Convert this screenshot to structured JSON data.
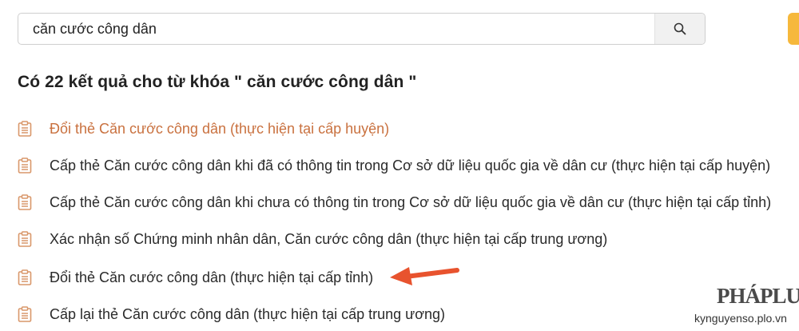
{
  "search": {
    "value": "căn cước công dân",
    "placeholder": ""
  },
  "results": {
    "heading": "Có 22 kết quả cho từ khóa \" căn cước công dân \"",
    "items": [
      "Đổi thẻ Căn cước công dân (thực hiện tại cấp huyện)",
      "Cấp thẻ Căn cước công dân khi đã có thông tin trong Cơ sở dữ liệu quốc gia về dân cư (thực hiện tại cấp huyện)",
      "Cấp thẻ Căn cước công dân khi chưa có thông tin trong Cơ sở dữ liệu quốc gia về dân cư (thực hiện tại cấp tỉnh)",
      "Xác nhận số Chứng minh nhân dân, Căn cước công dân (thực hiện tại cấp trung ương)",
      "Đổi thẻ Căn cước công dân (thực hiện tại cấp tỉnh)",
      "Cấp lại thẻ Căn cước công dân (thực hiện tại cấp trung ương)"
    ]
  },
  "watermark": {
    "logo": "PHÁPLUẬT",
    "domain": "kynguyenso.plo.vn"
  },
  "colors": {
    "accent": "#c9713f",
    "icon": "#d9976a",
    "arrow": "#e8532e",
    "tab": "#f6b83c"
  },
  "icons": {
    "search": "search-icon",
    "result": "document-icon",
    "annotation": "arrow-icon"
  }
}
